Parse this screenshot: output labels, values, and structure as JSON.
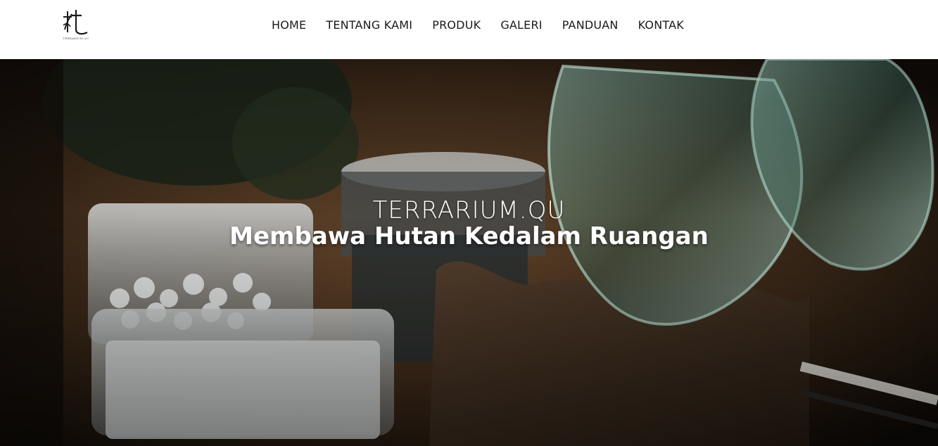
{
  "brand": {
    "logo_icon": "terrarium-qu-logo",
    "logo_caption": "TERRARIUM.QU"
  },
  "nav": {
    "items": [
      {
        "label": "HOME"
      },
      {
        "label": "TENTANG KAMI"
      },
      {
        "label": "PRODUK"
      },
      {
        "label": "GALERI"
      },
      {
        "label": "PANDUAN"
      },
      {
        "label": "KONTAK"
      }
    ]
  },
  "hero": {
    "subtitle": "TERRARIUM.QU",
    "title": "Membawa Hutan Kedalam Ruangan",
    "image": "terrarium-supplies-photo"
  },
  "colors": {
    "header_bg": "#ffffff",
    "nav_text": "#1a1a1a",
    "hero_text": "#ffffff"
  }
}
